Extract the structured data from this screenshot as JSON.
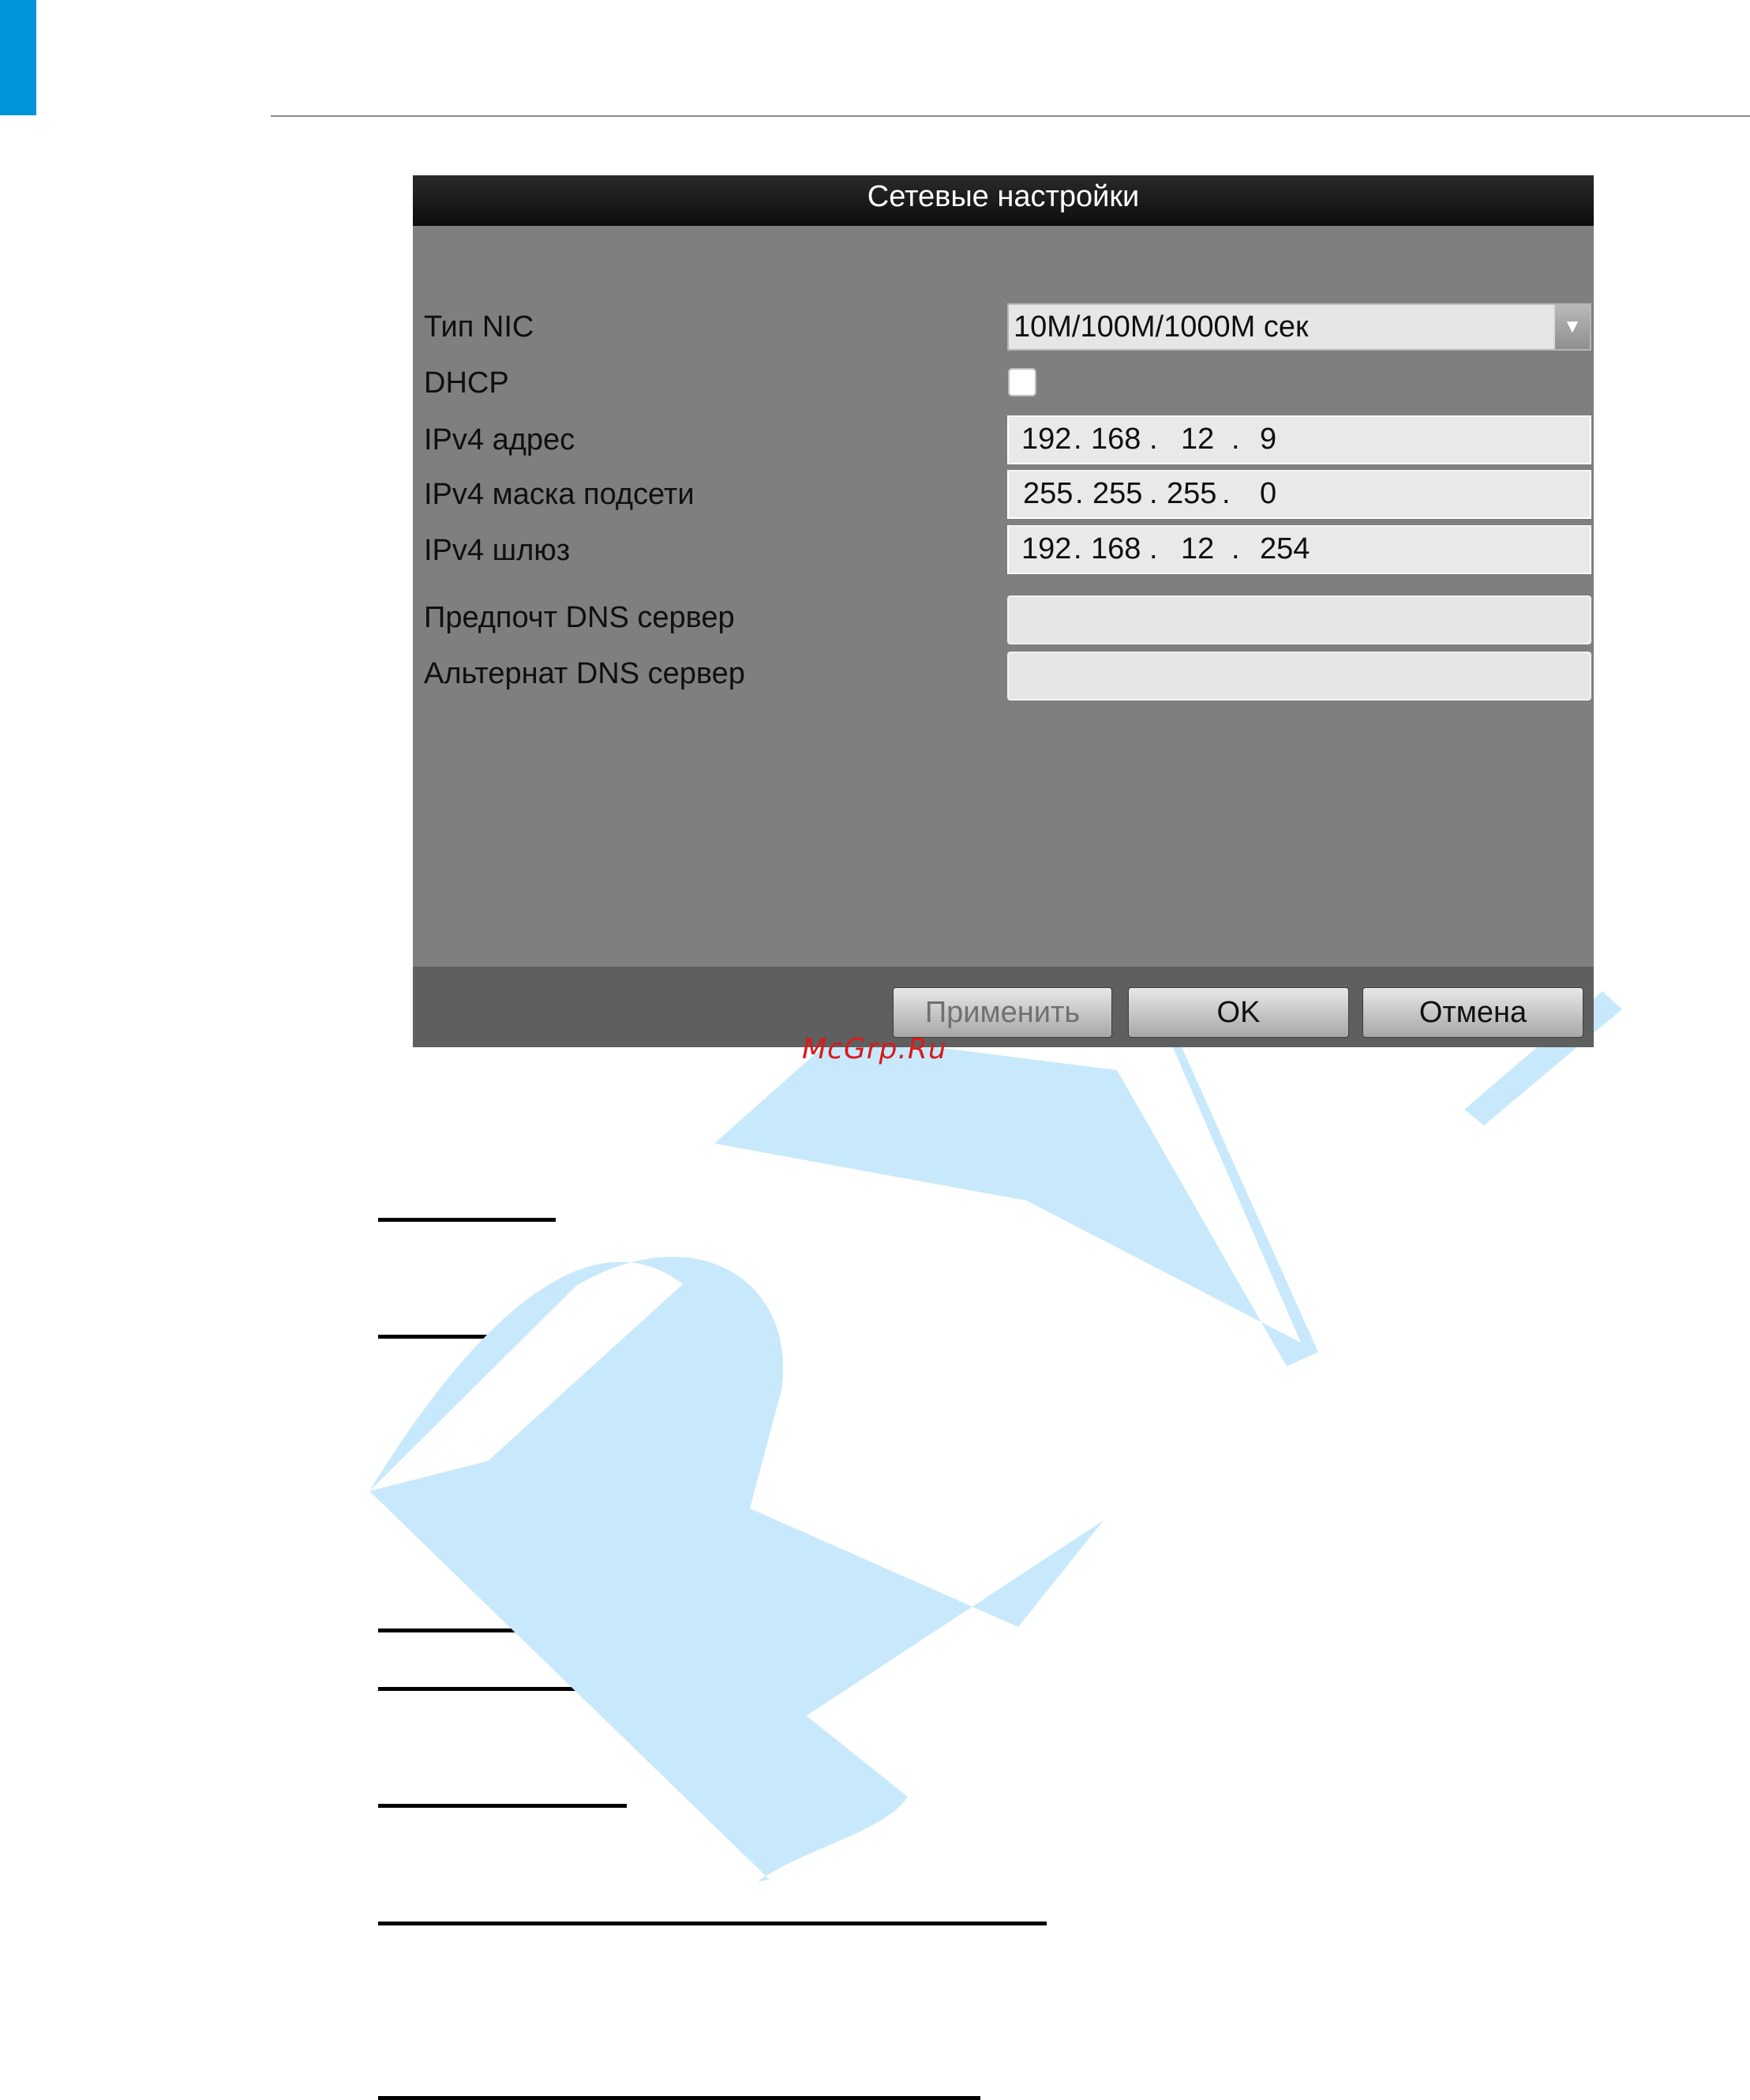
{
  "dialog": {
    "title": "Сетевые настройки",
    "fields": {
      "nic_type": {
        "label": "Тип NIC",
        "value": "10M/100M/1000M сек"
      },
      "dhcp": {
        "label": "DHCP",
        "checked": false
      },
      "ipv4_address": {
        "label": "IPv4 адрес",
        "octets": [
          "192",
          "168",
          "12",
          "9"
        ]
      },
      "ipv4_mask": {
        "label": "IPv4 маска подсети",
        "octets": [
          "255",
          "255",
          "255",
          "0"
        ]
      },
      "ipv4_gateway": {
        "label": "IPv4 шлюз",
        "octets": [
          "192",
          "168",
          "12",
          "254"
        ]
      },
      "preferred_dns": {
        "label": "Предпочт DNS сервер",
        "value": ""
      },
      "alternate_dns": {
        "label": "Альтернат DNS сервер",
        "value": ""
      }
    },
    "buttons": {
      "apply": "Применить",
      "ok": "OK",
      "cancel": "Отмена"
    }
  },
  "ip_separator": ".",
  "source_mark": "McGrp.Ru",
  "watermark": {
    "text": "RVi",
    "color": "#c8e9fb"
  },
  "colors": {
    "accent": "#0094d9",
    "dialog_bg": "#7f7f7f",
    "title_bar": "#111111",
    "button_bar": "#5f5f5f"
  }
}
